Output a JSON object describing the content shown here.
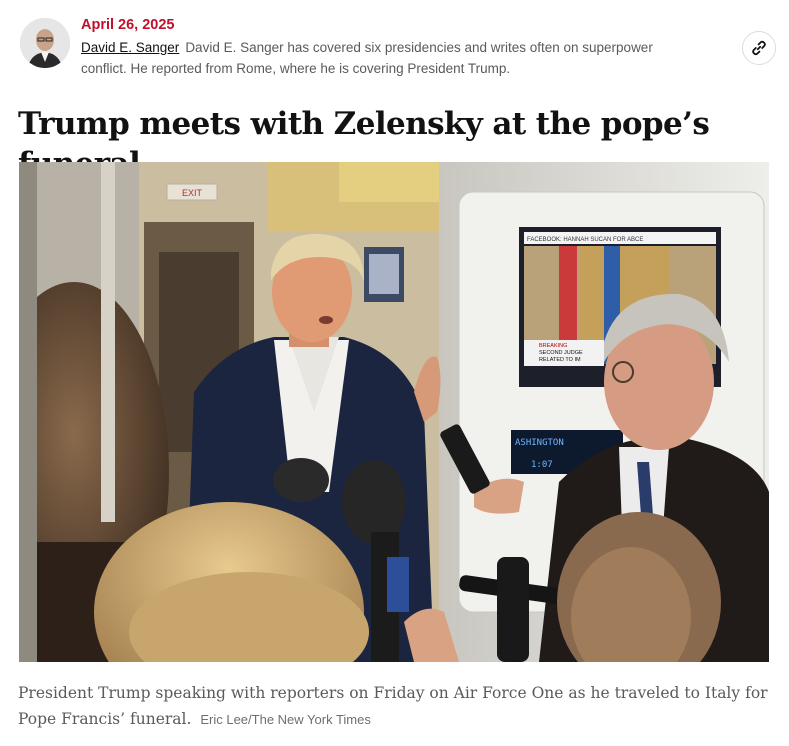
{
  "byline": {
    "date": "April 26, 2025",
    "author": "David E. Sanger",
    "bio": "David E. Sanger has covered six presidencies and writes often on superpower conflict. He reported from Rome, where he is covering President Trump.",
    "share_icon": "link-icon"
  },
  "headline": "Trump meets with Zelensky at the pope’s funeral.",
  "photo": {
    "exit_sign": "EXIT",
    "screen_ticker": "FACEBOOK: HANNAH SUCAN FOR ABCE",
    "screen_headline_1": "BREAKING",
    "screen_headline_2": "SECOND JUDGE",
    "screen_headline_3": "RELATED TO IM",
    "panel_city": "ASHINGTON",
    "panel_time": "1:07"
  },
  "caption": {
    "text": "President Trump speaking with reporters on Friday on Air Force One as he traveled to Italy for Pope Francis’ funeral.",
    "credit": "Eric Lee/The New York Times"
  },
  "colors": {
    "date_red": "#c0102b",
    "text": "#121212",
    "muted": "#5a5a5a"
  }
}
